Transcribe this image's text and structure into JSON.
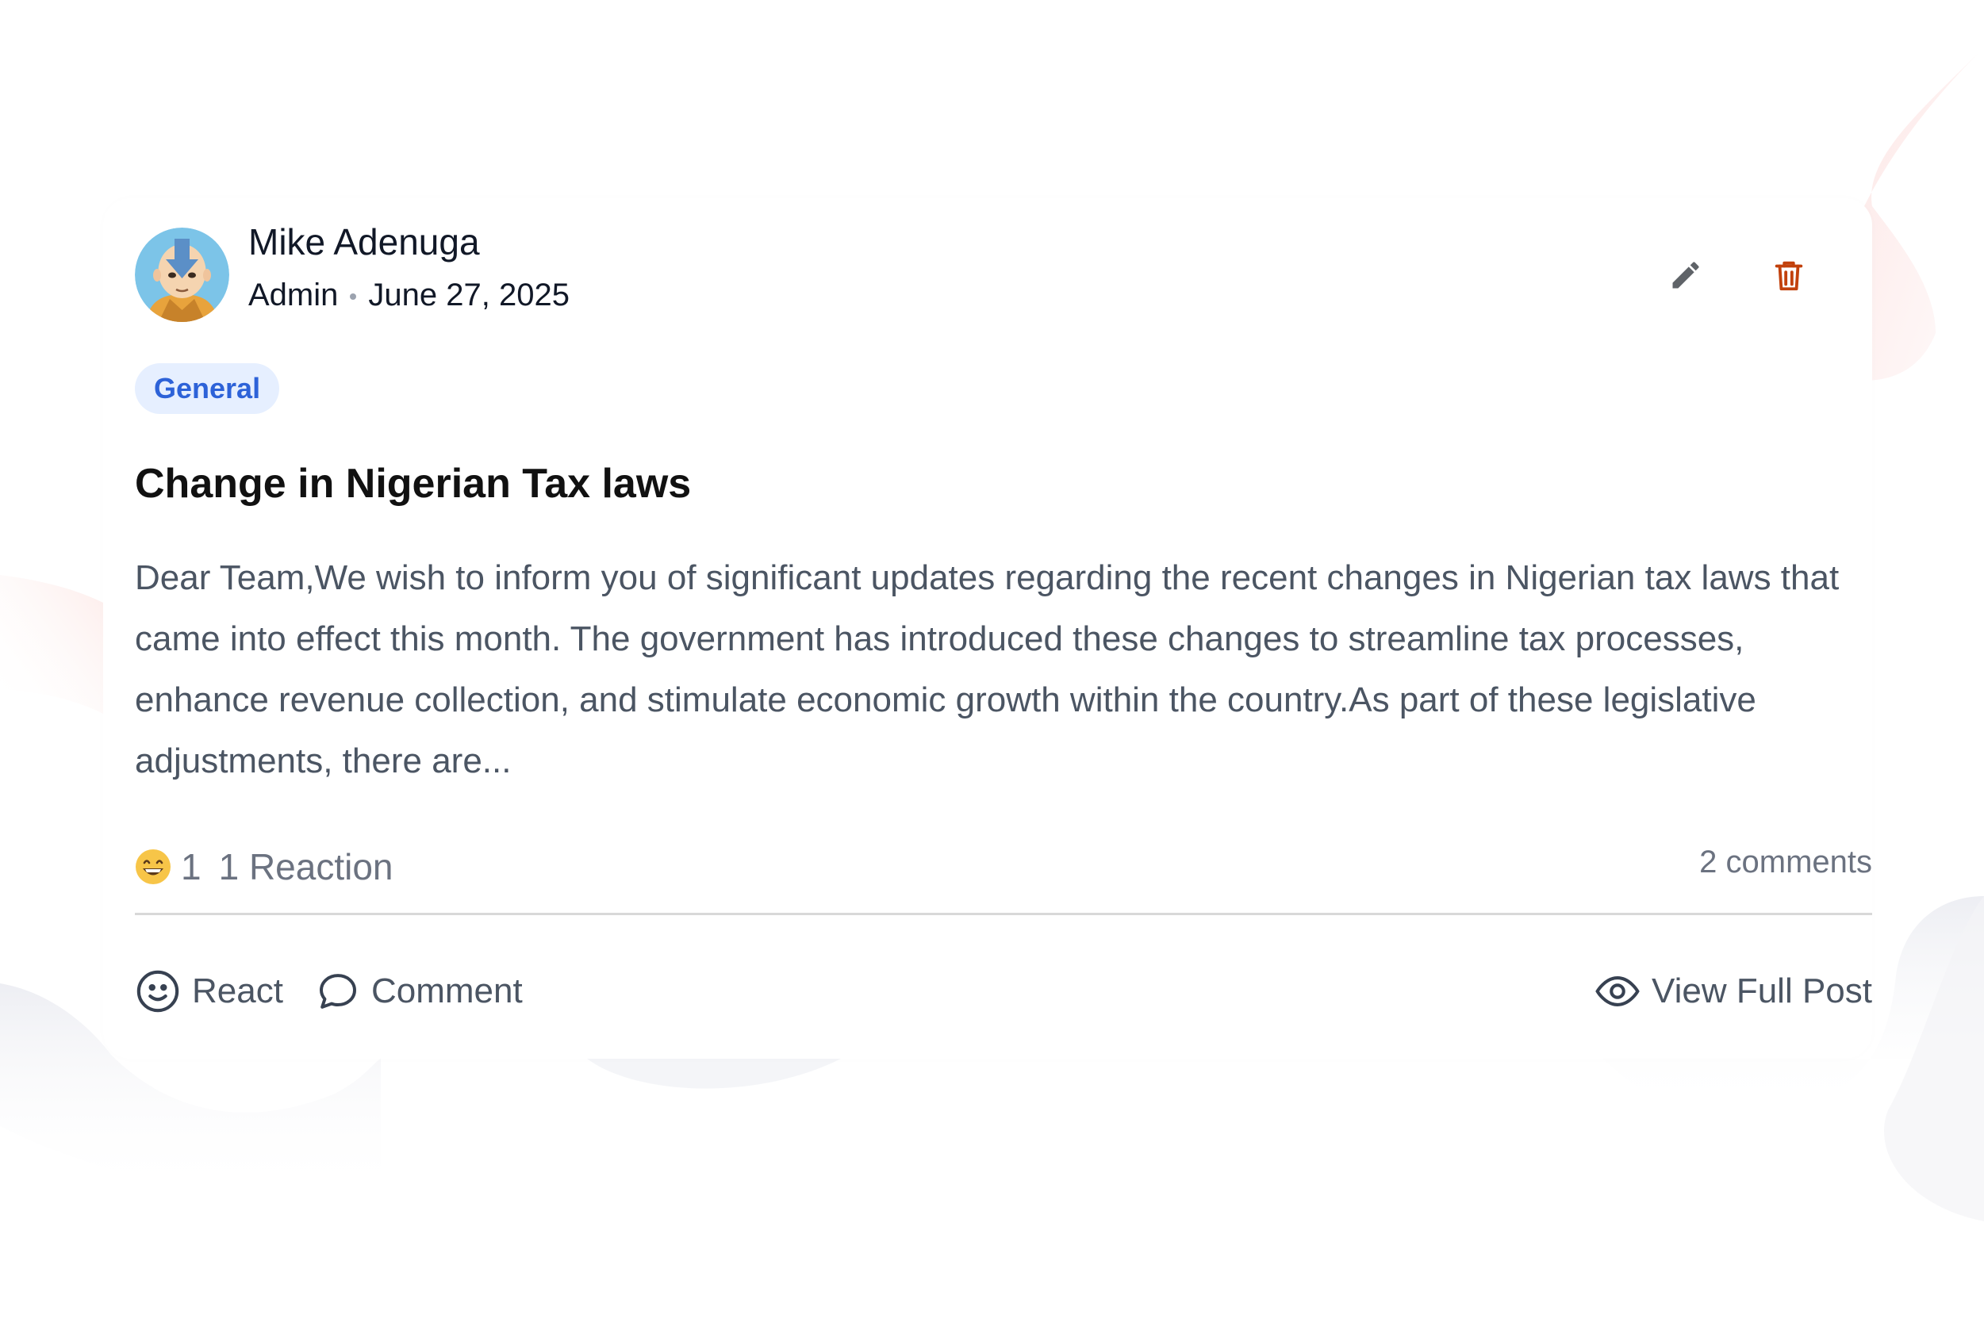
{
  "post": {
    "author_name": "Mike Adenuga",
    "author_role": "Admin",
    "date": "June 27, 2025",
    "category": "General",
    "title": "Change in Nigerian Tax laws",
    "excerpt": "Dear Team,We wish to inform you of significant updates regarding the recent changes in Nigerian tax laws that came into effect this month. The government has introduced these changes to streamline tax processes, enhance revenue collection, and stimulate economic growth within the country.As part of these legislative adjustments, there are..."
  },
  "reactions": {
    "emoji": "grinning-face-icon",
    "count": "1",
    "summary": "1 Reaction",
    "comments": "2 comments"
  },
  "actions": {
    "react_label": "React",
    "comment_label": "Comment",
    "view_label": "View Full Post"
  },
  "icons": {
    "edit": "pencil-icon",
    "delete": "trash-icon",
    "react": "smile-icon",
    "comment": "speech-bubble-icon",
    "view": "eye-icon"
  },
  "colors": {
    "tag_bg": "#e6efff",
    "tag_text": "#2d62d8",
    "delete": "#c2410c",
    "muted_text": "#4b5563",
    "divider": "#d8d8d8"
  }
}
